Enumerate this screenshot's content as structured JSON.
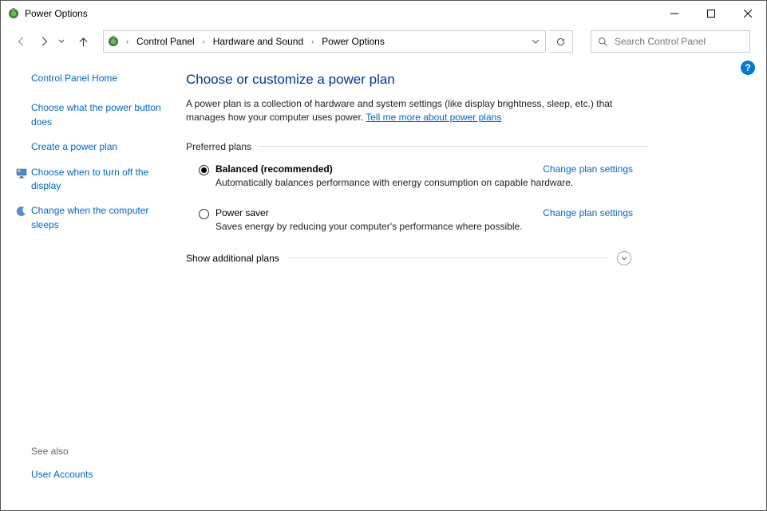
{
  "window": {
    "title": "Power Options"
  },
  "breadcrumb": {
    "items": [
      "Control Panel",
      "Hardware and Sound",
      "Power Options"
    ]
  },
  "search": {
    "placeholder": "Search Control Panel"
  },
  "sidebar": {
    "home": "Control Panel Home",
    "links": {
      "choose_button": "Choose what the power button does",
      "create_plan": "Create a power plan",
      "turn_off_display": "Choose when to turn off the display",
      "computer_sleeps": "Change when the computer sleeps"
    },
    "see_also_label": "See also",
    "see_also_link": "User Accounts"
  },
  "content": {
    "heading": "Choose or customize a power plan",
    "description_prefix": "A power plan is a collection of hardware and system settings (like display brightness, sleep, etc.) that manages how your computer uses power. ",
    "description_link": "Tell me more about power plans",
    "preferred_label": "Preferred plans",
    "additional_label": "Show additional plans",
    "change_link": "Change plan settings",
    "plans": [
      {
        "name": "Balanced (recommended)",
        "desc": "Automatically balances performance with energy consumption on capable hardware.",
        "selected": true
      },
      {
        "name": "Power saver",
        "desc": "Saves energy by reducing your computer's performance where possible.",
        "selected": false
      }
    ]
  }
}
